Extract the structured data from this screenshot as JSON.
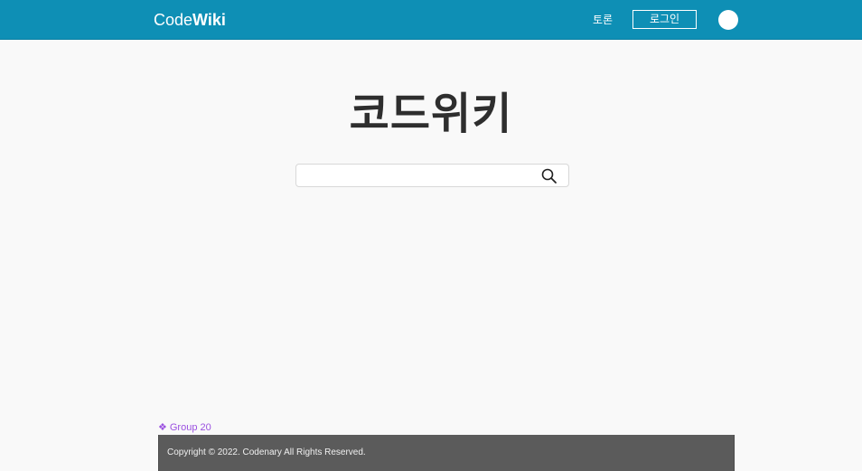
{
  "header": {
    "logo_light": "Code",
    "logo_bold": "Wiki",
    "discussion_link": "토론",
    "login_button": "로그인",
    "avatar_icon": "avatar-circle"
  },
  "main": {
    "title": "코드위키",
    "search": {
      "value": "",
      "placeholder": "",
      "icon": "search-icon"
    }
  },
  "group_label": {
    "icon": "❖",
    "text": "Group 20"
  },
  "footer": {
    "copyright": "Copyright © 2022. Codenary All Rights Reserved."
  },
  "colors": {
    "header_bg": "#0e8fb5",
    "page_bg": "#f9f9f9",
    "footer_bg": "#5b5b5b",
    "group_label": "#9b51e0"
  }
}
